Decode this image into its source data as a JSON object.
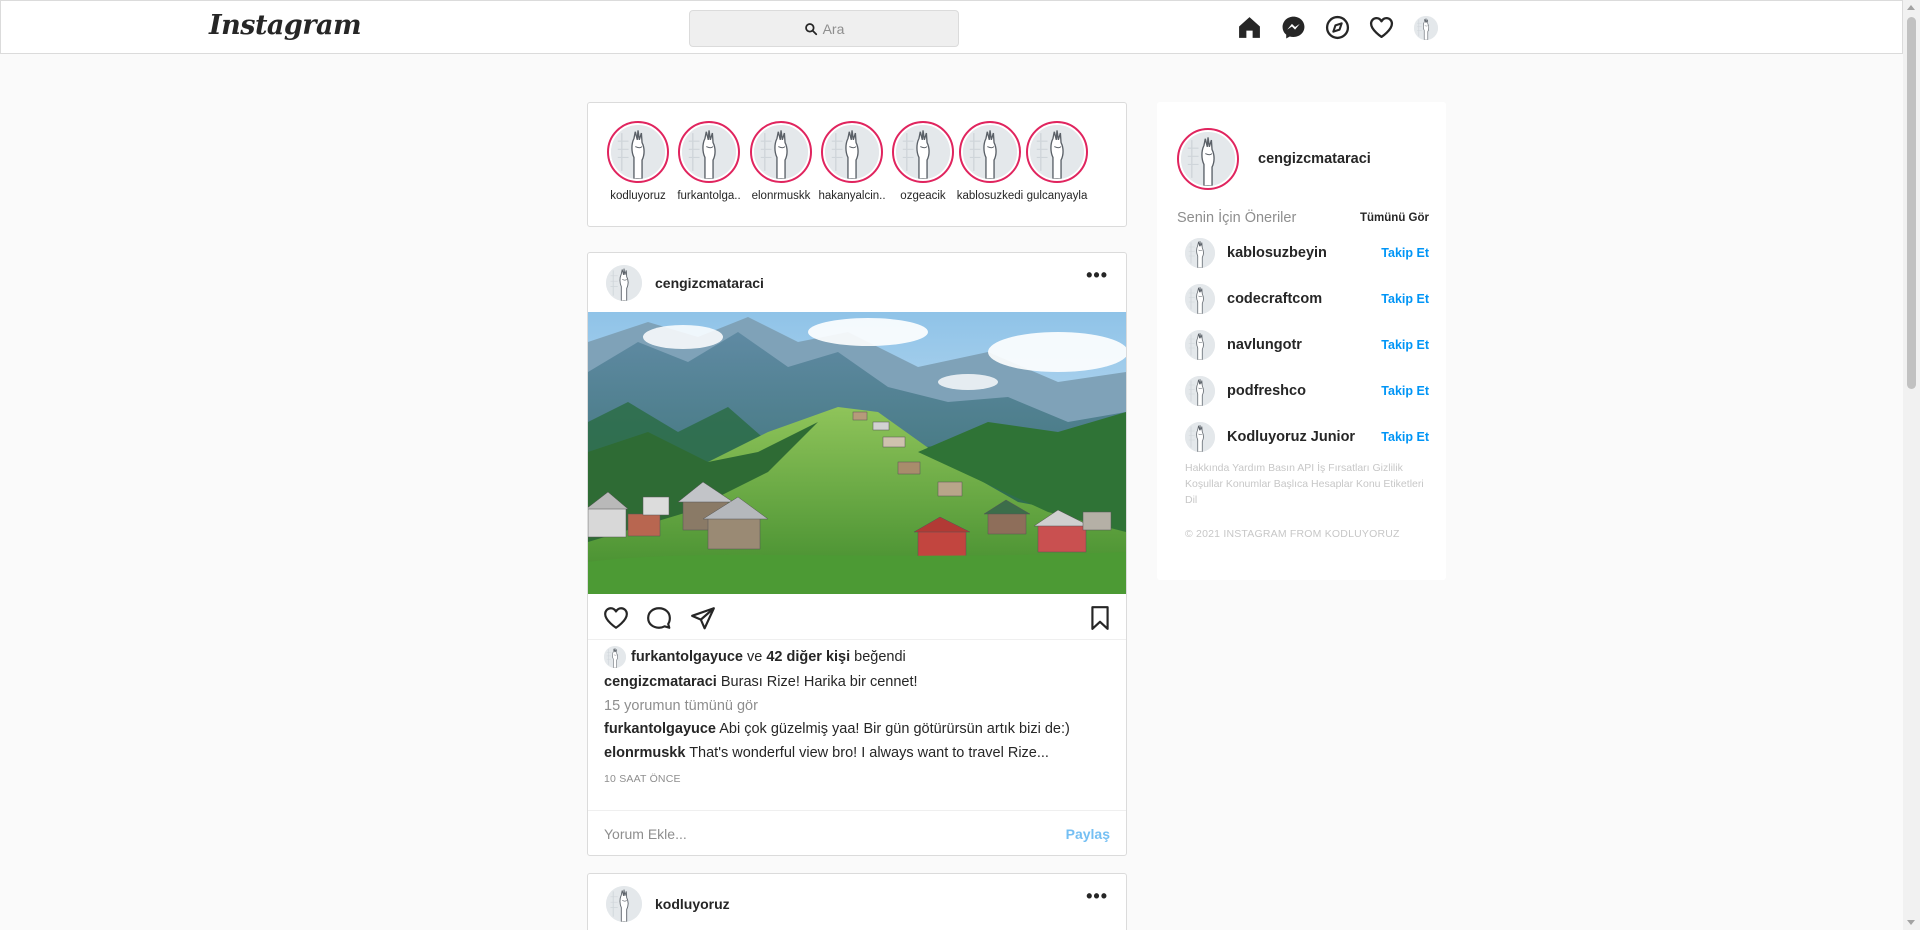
{
  "nav": {
    "logo": "Instagram",
    "search_placeholder": "Ara",
    "icons": [
      "home-icon",
      "messenger-icon",
      "explore-icon",
      "heart-icon",
      "profile-avatar"
    ]
  },
  "stories": [
    {
      "name": "kodluyoruz"
    },
    {
      "name": "furkantolga.."
    },
    {
      "name": "elonrmuskk"
    },
    {
      "name": "hakanyalcin.."
    },
    {
      "name": "ozgeacik"
    },
    {
      "name": "kablosuzkedi"
    },
    {
      "name": "gulcanyayla"
    }
  ],
  "post": {
    "username": "cengizcmataraci",
    "more": "•••",
    "likes": {
      "user": "furkantolgayuce",
      "connector": "ve",
      "others": "42 diğer kişi",
      "suffix": "beğendi"
    },
    "caption": {
      "user": "cengizcmataraci",
      "text": "Burası Rize! Harika bir cennet!"
    },
    "view_comments": "15 yorumun tümünü gör",
    "comments": [
      {
        "user": "furkantolgayuce",
        "text": "Abi çok güzelmiş yaa! Bir gün götürürsün artık bizi de:)"
      },
      {
        "user": "elonrmuskk",
        "text": "That's wonderful view bro! I always want to travel Rize..."
      }
    ],
    "time": "10 SAAT ÖNCE",
    "add_comment_placeholder": "Yorum Ekle...",
    "share_label": "Paylaş"
  },
  "post2": {
    "username": "kodluyoruz",
    "more": "•••"
  },
  "sidebar": {
    "username": "cengizcmataraci",
    "suggestions_title": "Senin İçin Öneriler",
    "see_all": "Tümünü Gör",
    "suggestions": [
      {
        "name": "kablosuzbeyin",
        "action": "Takip Et"
      },
      {
        "name": "codecraftcom",
        "action": "Takip Et"
      },
      {
        "name": "navlungotr",
        "action": "Takip Et"
      },
      {
        "name": "podfreshco",
        "action": "Takip Et"
      },
      {
        "name": "Kodluyoruz Junior",
        "action": "Takip Et"
      }
    ],
    "footer_links": "Hakkında Yardım Basın API İş Fırsatları Gizlilik Koşullar Konumlar Başlıca Hesaplar Konu Etiketleri Dil",
    "copyright": "© 2021 INSTAGRAM FROM KODLUYORUZ"
  },
  "colors": {
    "story_ring": "#e0245e",
    "link_blue": "#0095f6",
    "share_blue": "#74bff3",
    "muted": "#8e8e8e"
  }
}
